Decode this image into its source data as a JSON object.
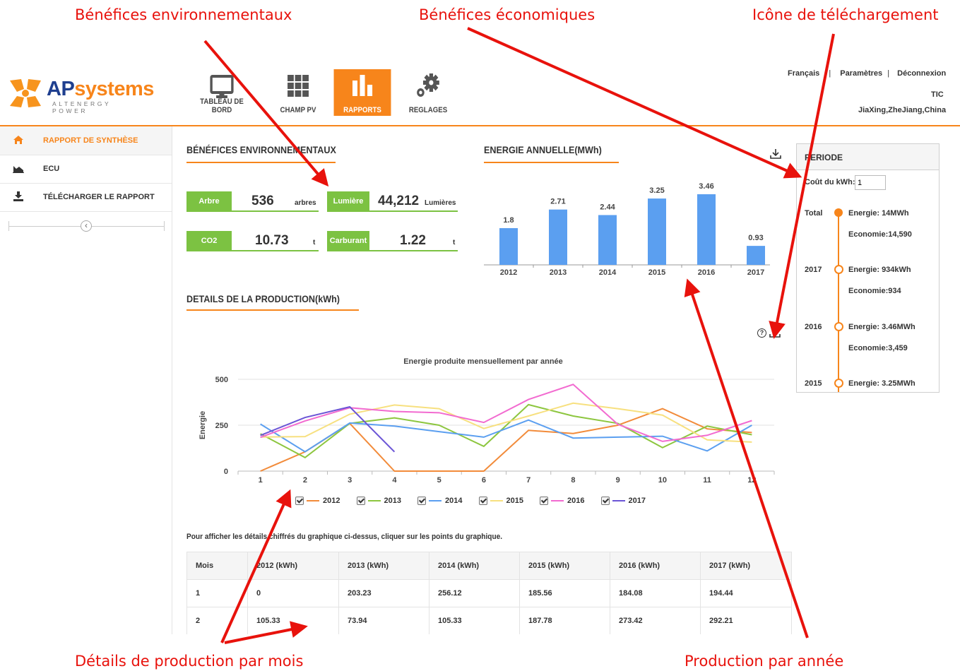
{
  "callouts": {
    "env": "Bénéfices environnementaux",
    "eco": "Bénéfices économiques",
    "download": "Icône de téléchargement",
    "monthly": "Détails de production par mois",
    "annual": "Production par année"
  },
  "logo": {
    "word_ap": "AP",
    "word_systems": "systems",
    "subtitle": "ALTENERGY POWER"
  },
  "nav": [
    {
      "label": "TABLEAU DE BORD",
      "icon": "monitor-icon"
    },
    {
      "label": "CHAMP PV",
      "icon": "grid-icon"
    },
    {
      "label": "RAPPORTS",
      "icon": "bar-chart-icon",
      "active": true
    },
    {
      "label": "REGLAGES",
      "icon": "gears-icon"
    }
  ],
  "toplinks": {
    "language": "Français",
    "sep": "|",
    "params": "Paramètres",
    "logout": "Déconnexion",
    "user": "TIC",
    "location": "JiaXing,ZheJiang,China"
  },
  "sidebar": {
    "items": [
      {
        "label": "RAPPORT DE SYNTHÈSE",
        "icon": "home-icon"
      },
      {
        "label": "ECU",
        "icon": "area-chart-icon"
      },
      {
        "label": "TÉLÉCHARGER LE RAPPORT",
        "icon": "download-icon"
      }
    ],
    "collapse_icon": "‹"
  },
  "env": {
    "title": "BÉNÉFICES ENVIRONNEMENTAUX",
    "tree": {
      "tag": "Arbre",
      "value": "536",
      "unit": "arbres"
    },
    "light": {
      "tag": "Lumière",
      "value": "44,212",
      "unit": "Lumières"
    },
    "co2": {
      "tag": "CO2",
      "value": "10.73",
      "unit": "t"
    },
    "fuel": {
      "tag": "Carburant",
      "value": "1.22",
      "unit": "t"
    }
  },
  "annual": {
    "title": "ENERGIE ANNUELLE(MWh)"
  },
  "production": {
    "title": "DETAILS DE LA PRODUCTION(kWh)",
    "help_icon": "?"
  },
  "chart_data": [
    {
      "type": "bar",
      "title": "ENERGIE ANNUELLE(MWh)",
      "categories": [
        "2012",
        "2013",
        "2014",
        "2015",
        "2016",
        "2017"
      ],
      "values": [
        1.8,
        2.71,
        2.44,
        3.25,
        3.46,
        0.93
      ],
      "labels": [
        "1.8",
        "2.71",
        "2.44",
        "3.25",
        "3.46",
        "0.93"
      ],
      "color": "#5b9ff0",
      "ylim": [
        0,
        3.46
      ]
    },
    {
      "type": "line",
      "title": "Energie produite mensuellement par année",
      "ylabel": "Energie",
      "x": [
        1,
        2,
        3,
        4,
        5,
        6,
        7,
        8,
        9,
        10,
        11,
        12
      ],
      "yticks": [
        0,
        250,
        500
      ],
      "ylim": [
        0,
        500
      ],
      "grid": true,
      "series": [
        {
          "name": "2012",
          "color": "#f28b3a",
          "values": [
            0,
            105.33,
            260,
            0,
            0,
            0,
            222,
            205,
            250,
            340,
            230,
            210
          ]
        },
        {
          "name": "2013",
          "color": "#8dc63f",
          "values": [
            203.23,
            73.94,
            260,
            290,
            250,
            135,
            362,
            300,
            260,
            128,
            245,
            198
          ]
        },
        {
          "name": "2014",
          "color": "#5b9ff0",
          "values": [
            256.12,
            105.33,
            262,
            245,
            215,
            185,
            278,
            180,
            185,
            190,
            110,
            250
          ]
        },
        {
          "name": "2015",
          "color": "#f7e07f",
          "values": [
            185.56,
            187.78,
            310,
            360,
            340,
            232,
            300,
            370,
            340,
            305,
            170,
            158
          ]
        },
        {
          "name": "2016",
          "color": "#f26bd0",
          "values": [
            184.08,
            273.42,
            345,
            325,
            318,
            265,
            390,
            472,
            255,
            162,
            195,
            275
          ]
        },
        {
          "name": "2017",
          "color": "#6b55d6",
          "values": [
            194.44,
            292.21,
            350,
            105
          ]
        }
      ]
    }
  ],
  "table": {
    "note": "Pour afficher les détails chiffrés du graphique ci-dessus, cliquer sur les points du graphique.",
    "headers": [
      "Mois",
      "2012 (kWh)",
      "2013 (kWh)",
      "2014 (kWh)",
      "2015 (kWh)",
      "2016 (kWh)",
      "2017 (kWh)"
    ],
    "rows": [
      [
        "1",
        "0",
        "203.23",
        "256.12",
        "185.56",
        "184.08",
        "194.44"
      ],
      [
        "2",
        "105.33",
        "73.94",
        "105.33",
        "187.78",
        "273.42",
        "292.21"
      ]
    ]
  },
  "periode": {
    "title": "PERIODE",
    "cost_label": "Coût du kWh:",
    "cost_value": "1",
    "entries": [
      {
        "year": "Total",
        "energy": "Energie: 14MWh",
        "economy": "Economie:14,590"
      },
      {
        "year": "2017",
        "energy": "Energie: 934kWh",
        "economy": "Economie:934"
      },
      {
        "year": "2016",
        "energy": "Energie: 3.46MWh",
        "economy": "Economie:3,459"
      },
      {
        "year": "2015",
        "energy": "Energie: 3.25MWh",
        "economy": ""
      }
    ]
  },
  "colors": {
    "accent": "#f7851b",
    "green": "#7cc242",
    "bar": "#5b9ff0",
    "arrow": "#e8120c"
  }
}
